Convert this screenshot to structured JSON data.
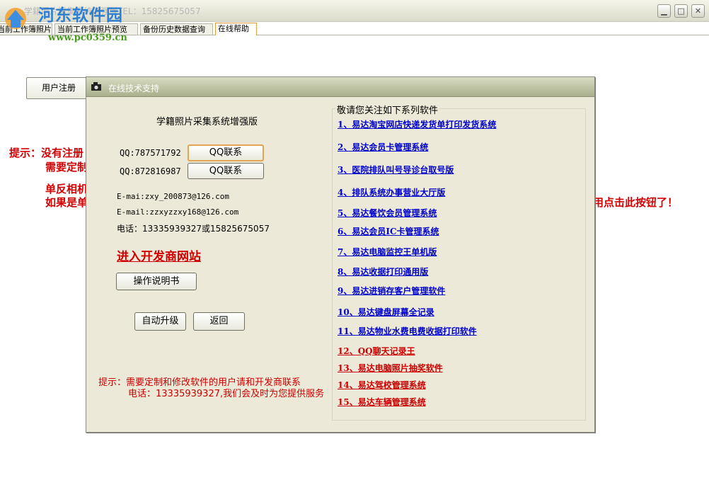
{
  "window": {
    "title": "学籍照片采集系统增强版TEL：15825675057",
    "min_glyph": "▁",
    "max_glyph": "□",
    "close_glyph": "✕"
  },
  "watermark": {
    "name": "河东软件园",
    "url": "www.pc0359.cn"
  },
  "tabs": [
    {
      "label": "当前工作簿照片",
      "active": false
    },
    {
      "label": "当前工作簿照片预览",
      "active": false
    },
    {
      "label": "备份历史数据查询",
      "active": false
    },
    {
      "label": "在线帮助",
      "active": true
    }
  ],
  "background": {
    "register_label": "用户注册",
    "hint_line1": "提示：没有注册",
    "hint_line2": "需要定制",
    "hint_line3": "单反相机",
    "hint_line4": "如果是单",
    "hint_tail": "用点击此按钮了！"
  },
  "dialog": {
    "title": "在线技术支持",
    "app_name": "学籍照片采集系统增强版",
    "qq1": "QQ:787571792",
    "qq2": "QQ:872816987",
    "qq_button": "QQ联系",
    "email1": "E-mai:zxy_200873@126.com",
    "email2": "E-mail:zzxyzzxy168@126.com",
    "phone": "电话：13335939327或15825675057",
    "dev_site": "进入开发商网站",
    "manual_button": "操作说明书",
    "upgrade_button": "自动升级",
    "back_button": "返回",
    "hint1": "提示：需要定制和修改软件的用户请和开发商联系",
    "hint2": "电话：13335939327,我们会及时为您提供服务",
    "group_title": "敬请您关注如下系列软件",
    "products": [
      {
        "label": "1、易达淘宝网店快递发货单打印发货系统",
        "color": "#0000cc"
      },
      {
        "label": "2、易达会员卡管理系统",
        "color": "#0000cc"
      },
      {
        "label": "3、医院排队叫号导诊台取号版",
        "color": "#0000cc"
      },
      {
        "label": "4、排队系统办事营业大厅版",
        "color": "#0000cc"
      },
      {
        "label": "5、易达餐饮会员管理系统",
        "color": "#0000cc"
      },
      {
        "label": "6、易达会员IC卡管理系统",
        "color": "#0000cc"
      },
      {
        "label": "7、易达电脑监控王单机版",
        "color": "#0000cc"
      },
      {
        "label": "8、易达收据打印通用版",
        "color": "#0000cc"
      },
      {
        "label": "9、易达进销存客户管理软件",
        "color": "#0000cc"
      },
      {
        "label": "10、易达键盘屏幕全记录",
        "color": "#0000cc"
      },
      {
        "label": "11、易达物业水费电费收据打印软件",
        "color": "#0000cc"
      },
      {
        "label": "12、QQ聊天记录王",
        "color": "#cc0000"
      },
      {
        "label": "13、易达电脑照片抽奖软件",
        "color": "#cc0000"
      },
      {
        "label": "14、易达驾校管理系统",
        "color": "#cc0000"
      },
      {
        "label": "15、易达车辆管理系统",
        "color": "#cc0000"
      }
    ]
  }
}
